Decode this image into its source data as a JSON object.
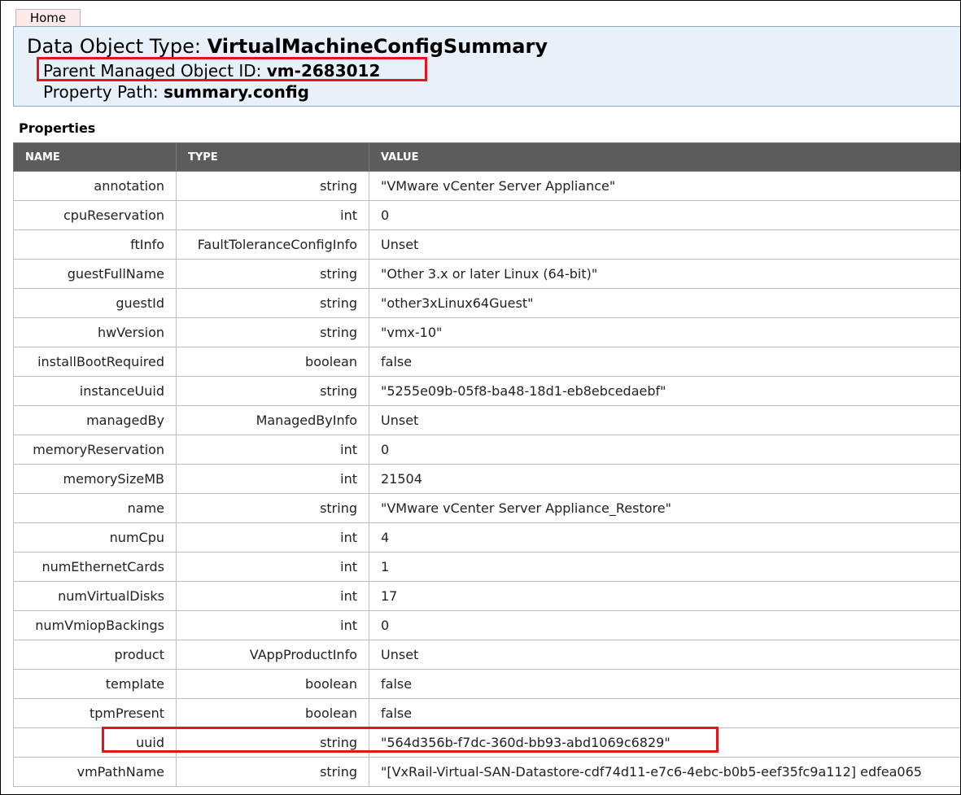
{
  "nav": {
    "home_label": "Home"
  },
  "header": {
    "type_label": "Data Object Type: ",
    "type_value": "VirtualMachineConfigSummary",
    "parent_label": "Parent Managed Object ID: ",
    "parent_value": "vm-2683012",
    "path_label": "Property Path: ",
    "path_value": "summary.config"
  },
  "properties": {
    "title": "Properties",
    "columns": [
      "NAME",
      "TYPE",
      "VALUE"
    ],
    "rows": [
      {
        "name": "annotation",
        "type": "string",
        "value": "\"VMware vCenter Server Appliance\""
      },
      {
        "name": "cpuReservation",
        "type": "int",
        "value": "0"
      },
      {
        "name": "ftInfo",
        "type": "FaultToleranceConfigInfo",
        "value": "Unset"
      },
      {
        "name": "guestFullName",
        "type": "string",
        "value": "\"Other 3.x or later Linux (64-bit)\""
      },
      {
        "name": "guestId",
        "type": "string",
        "value": "\"other3xLinux64Guest\""
      },
      {
        "name": "hwVersion",
        "type": "string",
        "value": "\"vmx-10\""
      },
      {
        "name": "installBootRequired",
        "type": "boolean",
        "value": "false"
      },
      {
        "name": "instanceUuid",
        "type": "string",
        "value": "\"5255e09b-05f8-ba48-18d1-eb8ebcedaebf\""
      },
      {
        "name": "managedBy",
        "type": "ManagedByInfo",
        "value": "Unset"
      },
      {
        "name": "memoryReservation",
        "type": "int",
        "value": "0"
      },
      {
        "name": "memorySizeMB",
        "type": "int",
        "value": "21504"
      },
      {
        "name": "name",
        "type": "string",
        "value": "\"VMware vCenter Server Appliance_Restore\""
      },
      {
        "name": "numCpu",
        "type": "int",
        "value": "4"
      },
      {
        "name": "numEthernetCards",
        "type": "int",
        "value": "1"
      },
      {
        "name": "numVirtualDisks",
        "type": "int",
        "value": "17"
      },
      {
        "name": "numVmiopBackings",
        "type": "int",
        "value": "0"
      },
      {
        "name": "product",
        "type": "VAppProductInfo",
        "value": "Unset"
      },
      {
        "name": "template",
        "type": "boolean",
        "value": "false"
      },
      {
        "name": "tpmPresent",
        "type": "boolean",
        "value": "false"
      },
      {
        "name": "uuid",
        "type": "string",
        "value": "\"564d356b-f7dc-360d-bb93-abd1069c6829\""
      },
      {
        "name": "vmPathName",
        "type": "string",
        "value": "\"[VxRail-Virtual-SAN-Datastore-cdf74d11-e7c6-4ebc-b0b5-eef35fc9a112] edfea065"
      }
    ]
  },
  "highlight_color": "#e4141b"
}
